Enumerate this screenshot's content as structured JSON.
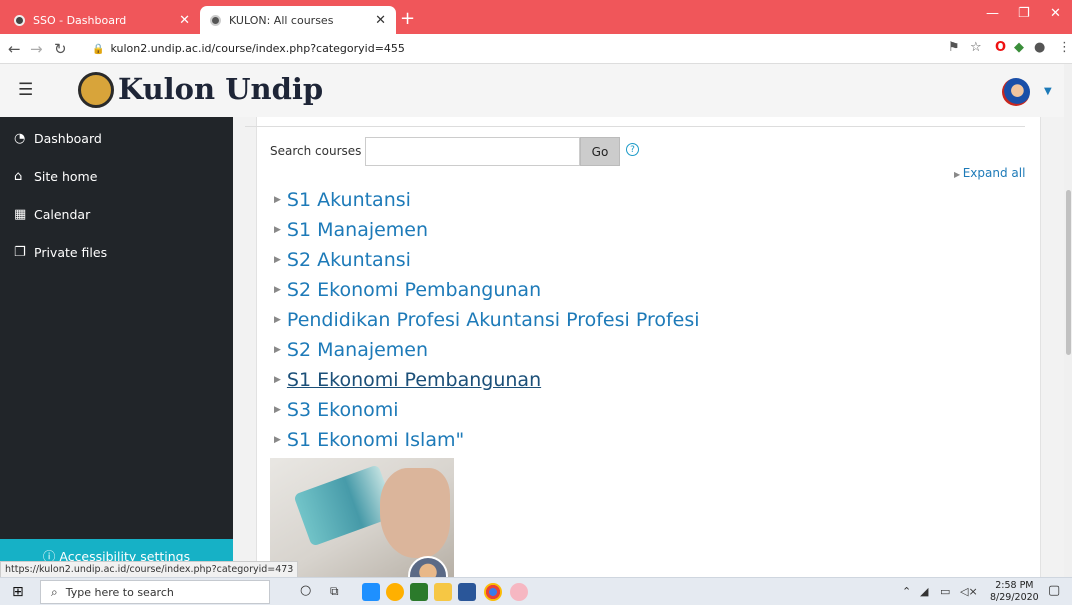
{
  "browser": {
    "tabs": [
      {
        "title": "SSO - Dashboard",
        "active": false
      },
      {
        "title": "KULON: All courses",
        "active": true
      }
    ],
    "new_tab": "+",
    "url": "kulon2.undip.ac.id/course/index.php?categoryid=455",
    "status_url": "https://kulon2.undip.ac.id/course/index.php?categoryid=473"
  },
  "header": {
    "brand": "Kulon Undip"
  },
  "sidebar": {
    "items": [
      {
        "label": "Dashboard",
        "icon": "dashboard-icon"
      },
      {
        "label": "Site home",
        "icon": "home-icon"
      },
      {
        "label": "Calendar",
        "icon": "calendar-icon"
      },
      {
        "label": "Private files",
        "icon": "files-icon"
      }
    ],
    "accessibility": "Accessibility settings"
  },
  "search": {
    "label": "Search courses",
    "value": "",
    "go": "Go"
  },
  "expand_all": "Expand all",
  "categories": [
    "S1 Akuntansi",
    "S1 Manajemen",
    "S2 Akuntansi",
    "S2 Ekonomi Pembangunan",
    "Pendidikan Profesi Akuntansi Profesi Profesi",
    "S2 Manajemen",
    "S1 Ekonomi Pembangunan",
    "S3 Ekonomi",
    "S1 Ekonomi Islam\""
  ],
  "taskbar": {
    "search_placeholder": "Type here to search",
    "time": "2:58 PM",
    "date": "8/29/2020"
  }
}
